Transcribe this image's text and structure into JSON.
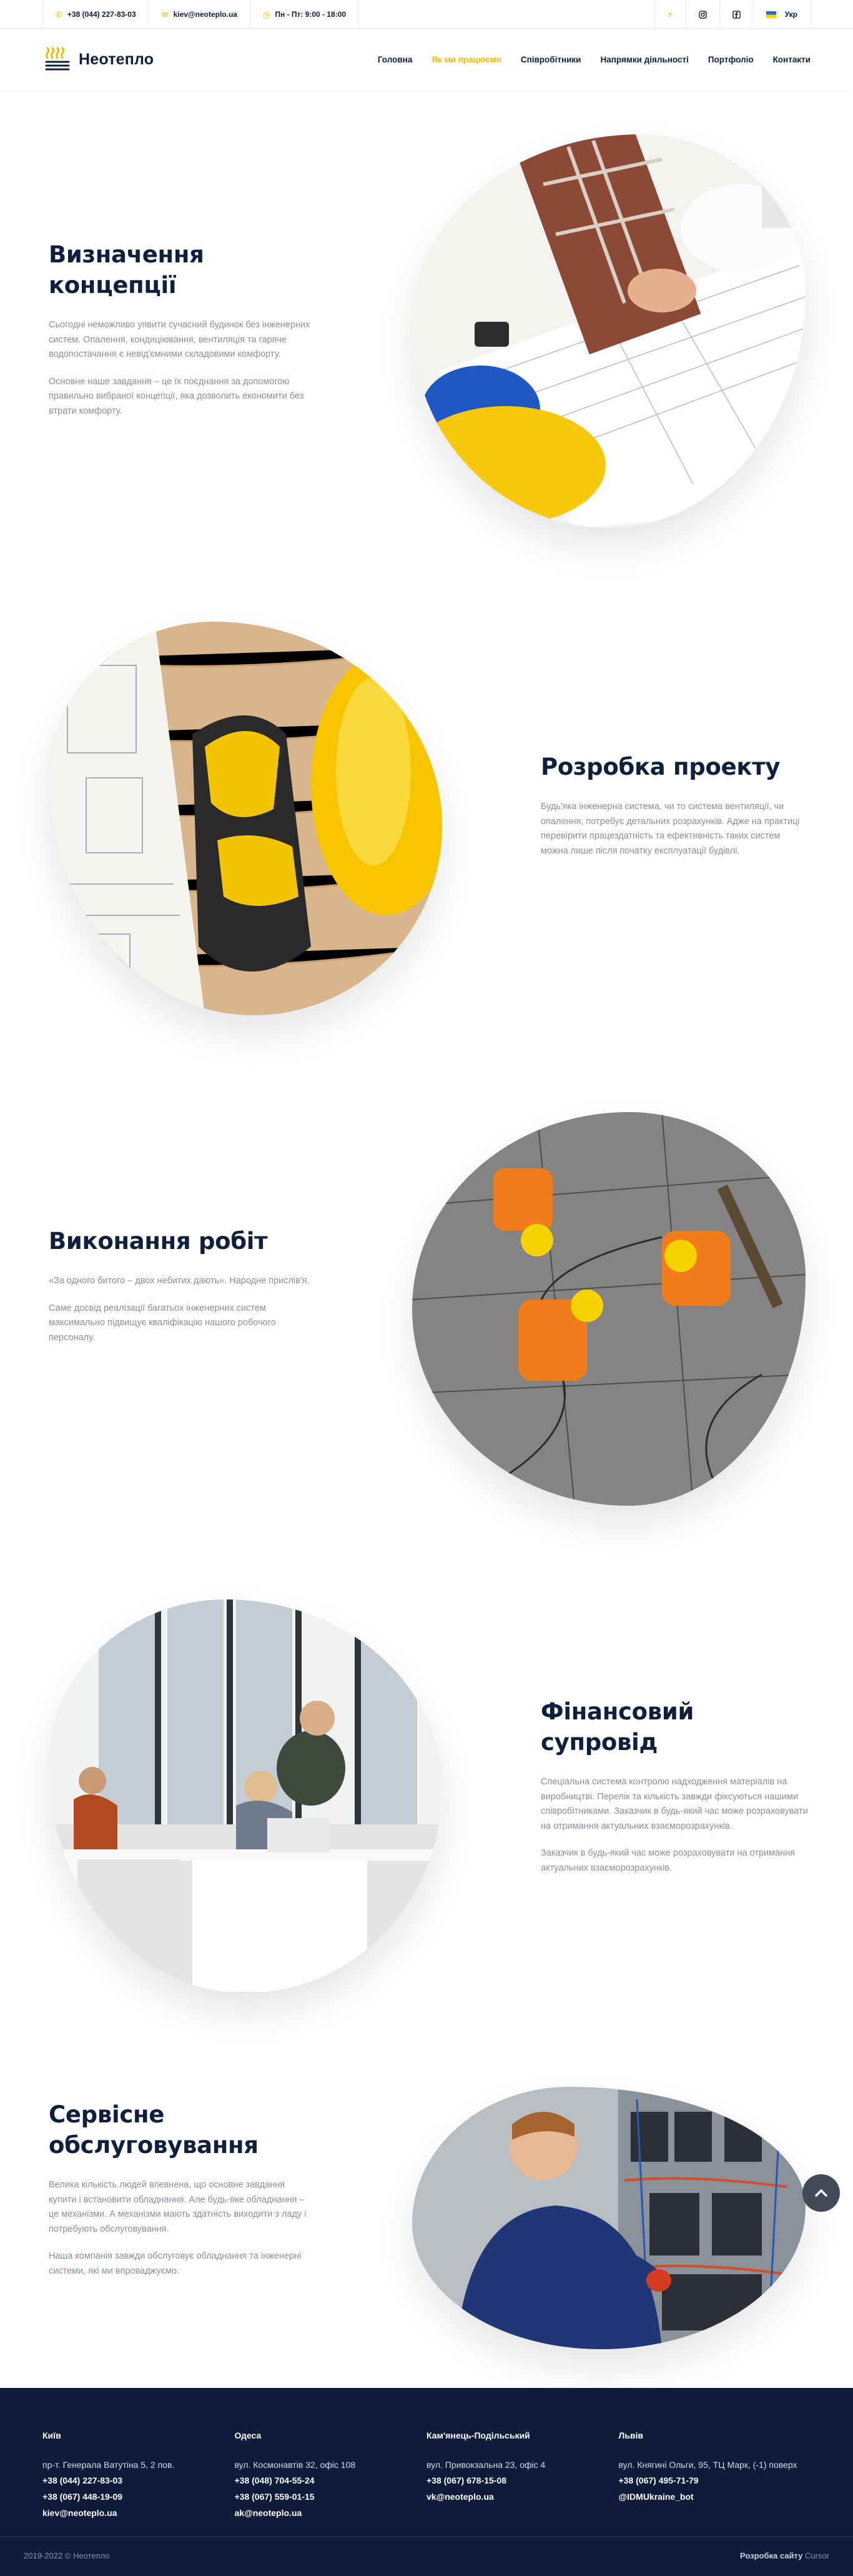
{
  "topbar": {
    "phone": "+38 (044) 227-83-03",
    "email": "kiev@neoteplo.ua",
    "hours": "Пн - Пт: 9:00 - 18:00",
    "language": "Укр",
    "icons": [
      "phone-icon",
      "mail-icon",
      "clock-icon",
      "flash-icon",
      "instagram-icon",
      "facebook-icon",
      "ukraine-flag-icon"
    ]
  },
  "header": {
    "logo_text": "Неотепло",
    "nav": [
      {
        "label": "Головна"
      },
      {
        "label": "Як ми працюємо"
      },
      {
        "label": "Співробітники"
      },
      {
        "label": "Напрямки діяльності"
      },
      {
        "label": "Портфоліо"
      },
      {
        "label": "Контакти"
      }
    ],
    "active_nav": "Як ми працюємо"
  },
  "sections": [
    {
      "title": "Визначення концепції",
      "paragraphs": [
        "Сьогодні неможливо уявити сучасний будинок без інженерних систем. Опалення, кондиціювання, вентиляція та гаряче водопостачання є невід'ємними складовими комфорту.",
        "Основне наше завдання – це їх поєднання за допомогою правильно вибраної концепції, яка дозволить економити без втрати комфорту."
      ]
    },
    {
      "title": "Розробка проекту",
      "paragraphs": [
        "Будь'яка інженерна система, чи то система вентиляції, чи опалення, потребує детальних розрахунків. Адже на практиці перевірити працездатність та ефективність таких систем можна лише після початку експлуатації будівлі."
      ]
    },
    {
      "title": "Виконання робіт",
      "paragraphs": [
        "«За одного битого – двох небитих дають». Народне прислів'я.",
        "Саме досвід реалізації багатьох інженерних систем максимально підвищує кваліфікацію нашого робочого персоналу."
      ]
    },
    {
      "title": "Фінансовий супровід",
      "paragraphs": [
        "Спеціальна система контролю надходження матеріалів на виробництві. Перелік та кількість завжди фіксуються нашими співробітниками. Заказчик в будь-який час може розраховувати на отримання актуальних взаєморозрахунків.",
        "Заказчик в будь-який час може розраховувати на отримання актуальних взаєморозрахунків."
      ]
    },
    {
      "title": "Сервісне обслуговування",
      "paragraphs": [
        "Велика кількість людей впевнена, що основне завдання купити і встановити обладнання. Але будь-яке обладнання – це механізми. А механізми мають здатність виходити з ладу і потребують обслуговування.",
        "Наша компанія завжди обслуговує обладнання та інженерні системи, які ми впроваджуємо."
      ]
    }
  ],
  "footer": {
    "offices": [
      {
        "city": "Київ",
        "address": "пр-т. Генерала Ватутіна 5, 2 пов.",
        "lines": [
          "+38 (044) 227-83-03",
          "+38 (067) 448-19-09",
          "kiev@neoteplo.ua"
        ]
      },
      {
        "city": "Одеса",
        "address": "вул. Космонавтів 32, офіс 108",
        "lines": [
          "+38 (048) 704-55-24",
          "+38 (067) 559-01-15",
          "ak@neoteplo.ua"
        ]
      },
      {
        "city": "Кам'янець-Подільський",
        "address": "вул. Привокзальна 23, офіс 4",
        "lines": [
          "+38 (067) 678-15-08",
          "vk@neoteplo.ua"
        ]
      },
      {
        "city": "Львів",
        "address": "вул. Княгині Ольги, 95, ТЦ Марк, (-1) поверх",
        "lines": [
          "+38 (067) 495-71-79",
          "@IDMUkraine_bot"
        ]
      }
    ],
    "copyright": "2019-2022 © Неотепло",
    "credit_label": "Розробка сайту",
    "credit_name": "Cursor"
  },
  "colors": {
    "accent": "#f5b700",
    "navy": "#0f1f3c",
    "footer_bg": "#0e1b3a",
    "text_muted": "#8a8f9c"
  }
}
